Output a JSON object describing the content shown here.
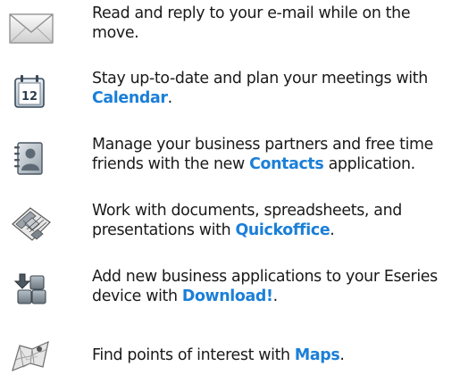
{
  "accent_color": "#1b7fd8",
  "items": [
    {
      "icon": "envelope-icon",
      "text_before": "Read and reply to your e-mail while on the move.",
      "link": "",
      "text_after": ""
    },
    {
      "icon": "calendar-icon",
      "icon_label": "12",
      "text_before": "Stay up-to-date and plan your meetings with ",
      "link": "Calendar",
      "text_after": "."
    },
    {
      "icon": "contacts-icon",
      "text_before": "Manage your business partners and free time friends with the new ",
      "link": "Contacts",
      "text_after": " application."
    },
    {
      "icon": "quickoffice-icon",
      "text_before": "Work with documents, spreadsheets, and presentations with ",
      "link": "Quickoffice",
      "text_after": "."
    },
    {
      "icon": "download-icon",
      "text_before": "Add new business applications to your Eseries device with ",
      "link": "Download!",
      "text_after": "."
    },
    {
      "icon": "maps-icon",
      "text_before": "Find points of interest with ",
      "link": "Maps",
      "text_after": "."
    }
  ]
}
